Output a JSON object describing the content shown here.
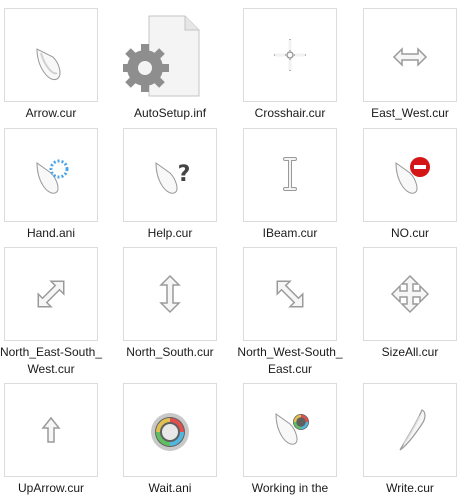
{
  "files": [
    {
      "name": "Arrow.cur",
      "icon": "arrow-cursor-icon"
    },
    {
      "name": "AutoSetup.inf",
      "icon": "settings-file-icon"
    },
    {
      "name": "Crosshair.cur",
      "icon": "crosshair-cursor-icon"
    },
    {
      "name": "East_West.cur",
      "icon": "east-west-cursor-icon"
    },
    {
      "name": "Hand.ani",
      "icon": "hand-busy-cursor-icon"
    },
    {
      "name": "Help.cur",
      "icon": "help-cursor-icon"
    },
    {
      "name": "IBeam.cur",
      "icon": "ibeam-cursor-icon"
    },
    {
      "name": "NO.cur",
      "icon": "no-cursor-icon"
    },
    {
      "name": "North_East-South_West.cur",
      "icon": "north-east-south-west-cursor-icon"
    },
    {
      "name": "North_South.cur",
      "icon": "north-south-cursor-icon"
    },
    {
      "name": "North_West-South_East.cur",
      "icon": "north-west-south-east-cursor-icon"
    },
    {
      "name": "SizeAll.cur",
      "icon": "size-all-cursor-icon"
    },
    {
      "name": "UpArrow.cur",
      "icon": "up-arrow-cursor-icon"
    },
    {
      "name": "Wait.ani",
      "icon": "wait-cursor-icon"
    },
    {
      "name": "Working in the",
      "icon": "working-cursor-icon"
    },
    {
      "name": "Write.cur",
      "icon": "pen-cursor-icon"
    }
  ]
}
